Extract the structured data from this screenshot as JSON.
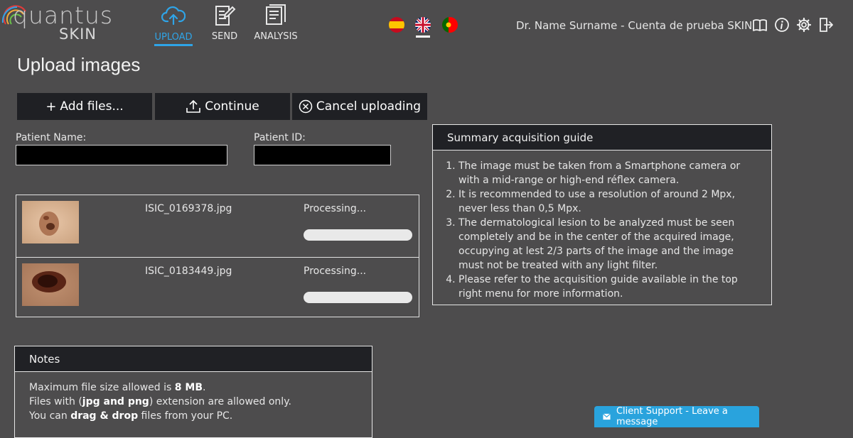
{
  "brand": {
    "name": "quantus",
    "product": "SKIN",
    "logo_colors": [
      "#e53b3b",
      "#f2a93b",
      "#6cc24a",
      "#2fa4e7"
    ]
  },
  "nav": [
    {
      "label": "UPLOAD",
      "icon": "cloud-upload-icon",
      "active": true
    },
    {
      "label": "SEND",
      "icon": "document-edit-icon",
      "active": false
    },
    {
      "label": "ANALYSIS",
      "icon": "document-list-icon",
      "active": false
    }
  ],
  "languages": [
    {
      "code": "es",
      "icon": "spain-flag-icon",
      "selected": false
    },
    {
      "code": "en",
      "icon": "uk-flag-icon",
      "selected": true
    },
    {
      "code": "pt",
      "icon": "portugal-flag-icon",
      "selected": false
    }
  ],
  "user": {
    "name": "Dr. Name Surname - Cuenta de prueba SKIN"
  },
  "toolbar_icons": [
    "book-icon",
    "info-icon",
    "gear-icon",
    "logout-icon"
  ],
  "page": {
    "title": "Upload images"
  },
  "buttons": {
    "add_files": "Add files...",
    "continue": "Continue",
    "cancel": "Cancel uploading"
  },
  "form": {
    "patient_name": {
      "label": "Patient Name:",
      "value": ""
    },
    "patient_id": {
      "label": "Patient ID:",
      "value": ""
    }
  },
  "files": [
    {
      "name": "ISIC_0169378.jpg",
      "status": "Processing...",
      "progress": 0
    },
    {
      "name": "ISIC_0183449.jpg",
      "status": "Processing...",
      "progress": 0
    }
  ],
  "guide": {
    "title": "Summary acquisition guide",
    "items": [
      "The image must be taken from a Smartphone camera or with a mid-range or high-end réflex camera.",
      "It is recommended to use a resolution of around 2 Mpx, never less than 0,5 Mpx.",
      "The dermatological lesion to be analyzed must be seen completely and be in the center of the acquired image, occupying at lest 2/3 parts of the image and the image must not be treated with any light filter.",
      "Please refer to the acquisition guide available in the top right menu for more information."
    ]
  },
  "notes": {
    "title": "Notes",
    "line1_pre": "Maximum file size allowed is ",
    "line1_bold": "8 MB",
    "line1_post": ".",
    "line2_pre": "Files with (",
    "line2_bold": "jpg and png",
    "line2_post": ") extension are allowed only.",
    "line3_pre": "You can ",
    "line3_bold": "drag & drop",
    "line3_post": " files from your PC."
  },
  "support": {
    "label": "Client Support - Leave a message",
    "icon": "envelope-icon"
  },
  "colors": {
    "accent": "#2fa4e7",
    "background": "#4d4c4d",
    "button_bg": "#1f2024",
    "support_bg": "#29a3dd"
  }
}
